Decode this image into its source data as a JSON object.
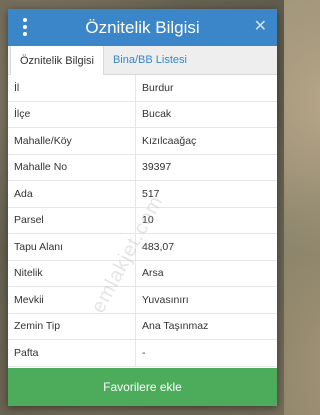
{
  "dialog": {
    "title": "Öznitelik Bilgisi",
    "close_glyph": "✕",
    "menu_icon": "kebab-menu-icon"
  },
  "tabs": [
    {
      "label": "Öznitelik Bilgisi",
      "active": true
    },
    {
      "label": "Bina/BB Listesi",
      "active": false
    }
  ],
  "rows": [
    {
      "key": "İl",
      "value": "Burdur"
    },
    {
      "key": "İlçe",
      "value": "Bucak"
    },
    {
      "key": "Mahalle/Köy",
      "value": "Kızılcaağaç"
    },
    {
      "key": "Mahalle No",
      "value": "39397"
    },
    {
      "key": "Ada",
      "value": "517"
    },
    {
      "key": "Parsel",
      "value": "10"
    },
    {
      "key": "Tapu Alanı",
      "value": "483,07"
    },
    {
      "key": "Nitelik",
      "value": "Arsa"
    },
    {
      "key": "Mevkii",
      "value": "Yuvasınırı"
    },
    {
      "key": "Zemin Tip",
      "value": "Ana Taşınmaz"
    },
    {
      "key": "Pafta",
      "value": "-"
    }
  ],
  "watermark": "emlakjet.com",
  "favorite_button": "Favorilere ekle",
  "colors": {
    "header": "#3a86c8",
    "button": "#4dab5c",
    "tab_link": "#3a86c8"
  }
}
